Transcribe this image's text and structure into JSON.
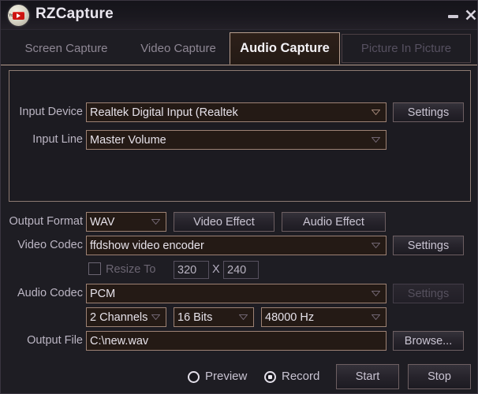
{
  "window": {
    "title": "RZCapture",
    "icon": "youtube-app-icon",
    "minimize_label": "minimize-icon",
    "close_label": "close-icon"
  },
  "tabs": [
    {
      "label": "Screen Capture",
      "state": "inactive"
    },
    {
      "label": "Video Capture",
      "state": "inactive"
    },
    {
      "label": "Audio Capture",
      "state": "active"
    },
    {
      "label": "Picture In Picture",
      "state": "disabled"
    }
  ],
  "input_group": {
    "input_device": {
      "label": "Input Device",
      "value": "Realtek Digital Input (Realtek",
      "settings_label": "Settings",
      "settings_enabled": true
    },
    "input_line": {
      "label": "Input Line",
      "value": "Master Volume"
    }
  },
  "output": {
    "format": {
      "label": "Output Format",
      "value": "WAV"
    },
    "video_effect_label": "Video Effect",
    "audio_effect_label": "Audio Effect",
    "video_codec": {
      "label": "Video Codec",
      "value": "ffdshow video encoder",
      "settings_label": "Settings",
      "settings_enabled": true
    },
    "resize": {
      "label": "Resize To",
      "checked": false,
      "width": "320",
      "separator": "X",
      "height": "240"
    },
    "audio_codec": {
      "label": "Audio Codec",
      "value": "PCM",
      "settings_label": "Settings",
      "settings_enabled": false
    },
    "channels": "2 Channels",
    "bits": "16 Bits",
    "samplerate": "48000 Hz",
    "output_file": {
      "label": "Output File",
      "value": "C:\\new.wav",
      "browse_label": "Browse..."
    }
  },
  "footer": {
    "preview_label": "Preview",
    "record_label": "Record",
    "mode_selected": "Record",
    "start_label": "Start",
    "stop_label": "Stop"
  },
  "colors": {
    "window_bg": "#1e1d23",
    "field_bg": "#241a15",
    "accent_border": "#9d8274",
    "active_tab_border": "#b79e8e",
    "text": "#e6e2ea",
    "text_dim": "#6b6572"
  }
}
